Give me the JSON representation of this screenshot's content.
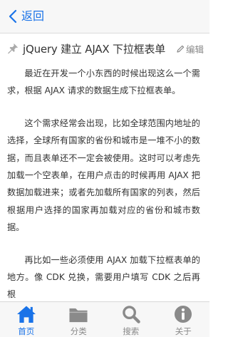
{
  "header": {
    "back_label": "返回"
  },
  "article": {
    "title": "jQuery 建立 AJAX 下拉框表单",
    "edit_label": "编辑",
    "paragraphs": [
      "最近在开发一个小东西的时候出现这么一个需求，根据 AJAX 请求的数据生成下拉框表单。",
      "这个需求经常会出现，比如全球范围内地址的选择，全球所有国家的省份和城市是一堆不小的数据，而且表单还不一定会被使用。这时可以考虑先加载一个空表单，在用户点击的时候再用 AJAX 把数据加载进来；或者先加载所有国家的列表，然后根据用户选择的国家再加载对应的省份和城市数据。",
      "再比如一些必须使用 AJAX 加载下拉框表单的地方。像 CDK 兑换，需要用户填写 CDK 之后再根"
    ]
  },
  "tabbar": {
    "tabs": [
      {
        "label": "首页",
        "icon": "home-icon",
        "active": true
      },
      {
        "label": "分类",
        "icon": "folder-icon",
        "active": false
      },
      {
        "label": "搜索",
        "icon": "search-icon",
        "active": false
      },
      {
        "label": "关于",
        "icon": "info-icon",
        "active": false
      }
    ]
  },
  "colors": {
    "accent": "#1a73e8",
    "inactive_icon": "#8a8a8a",
    "bar_background": "#f7f7f7"
  }
}
